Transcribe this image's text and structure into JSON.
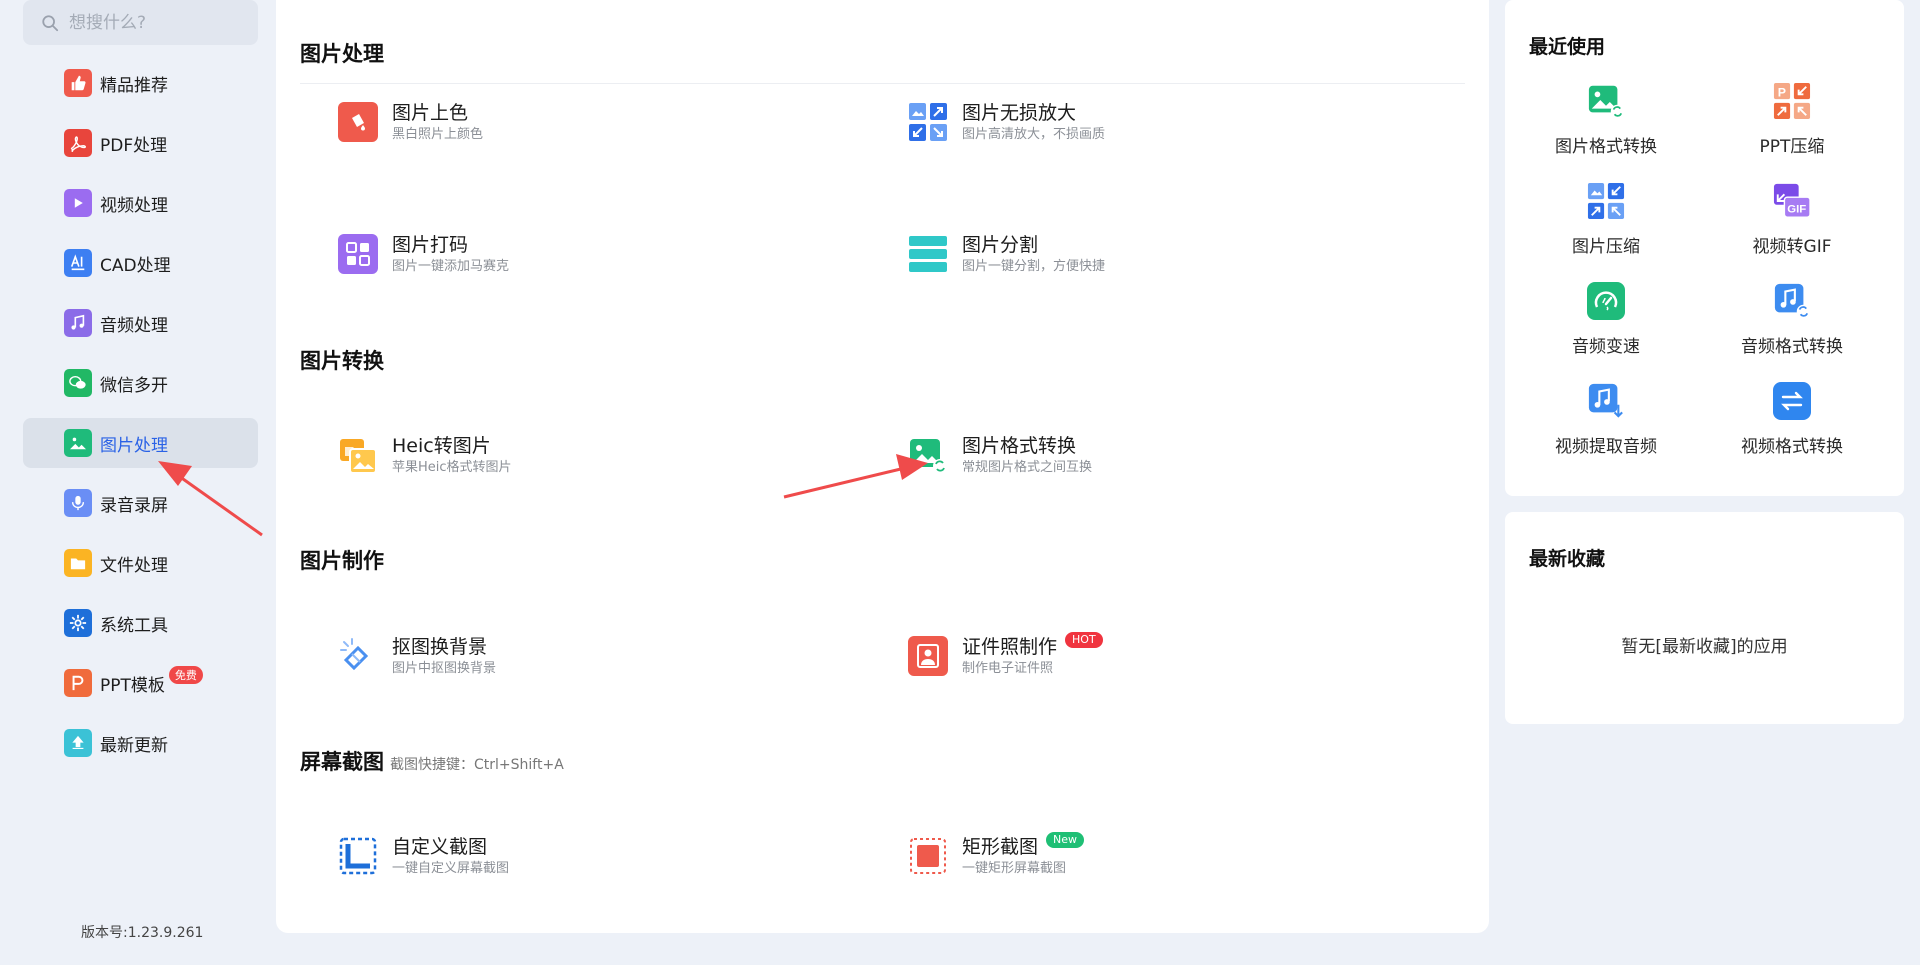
{
  "search": {
    "placeholder": "想搜什么?"
  },
  "sidebar": {
    "items": [
      {
        "label": "精品推荐",
        "color": "#ef5a4c"
      },
      {
        "label": "PDF处理",
        "color": "#e8453c"
      },
      {
        "label": "视频处理",
        "color": "#9b6cf0"
      },
      {
        "label": "CAD处理",
        "color": "#3d7ff2"
      },
      {
        "label": "音频处理",
        "color": "#8b6ce8"
      },
      {
        "label": "微信多开",
        "color": "#21b865"
      },
      {
        "label": "图片处理",
        "color": "#1fbb7b"
      },
      {
        "label": "录音录屏",
        "color": "#6a8ef5"
      },
      {
        "label": "文件处理",
        "color": "#fbb423"
      },
      {
        "label": "系统工具",
        "color": "#1e6fd9"
      },
      {
        "label": "PPT模板",
        "color": "#f06b3c",
        "badge": "免费"
      },
      {
        "label": "最新更新",
        "color": "#3bc2d6"
      }
    ],
    "version": "版本号:1.23.9.261"
  },
  "main": {
    "sections": [
      {
        "title": "图片处理",
        "subtitle": ""
      },
      {
        "title": "图片转换",
        "subtitle": ""
      },
      {
        "title": "图片制作",
        "subtitle": ""
      },
      {
        "title": "屏幕截图",
        "subtitle": "截图快捷键：Ctrl+Shift+A"
      }
    ],
    "tools": [
      {
        "name": "图片上色",
        "desc": "黑白照片上颜色"
      },
      {
        "name": "图片无损放大",
        "desc": "图片高清放大，不损画质"
      },
      {
        "name": "图片打码",
        "desc": "图片一键添加马赛克"
      },
      {
        "name": "图片分割",
        "desc": "图片一键分割，方便快捷"
      },
      {
        "name": "Heic转图片",
        "desc": "苹果Heic格式转图片"
      },
      {
        "name": "图片格式转换",
        "desc": "常规图片格式之间互换"
      },
      {
        "name": "抠图换背景",
        "desc": "图片中抠图换背景"
      },
      {
        "name": "证件照制作",
        "desc": "制作电子证件照",
        "badge": "HOT"
      },
      {
        "name": "自定义截图",
        "desc": "一键自定义屏幕截图"
      },
      {
        "name": "矩形截图",
        "desc": "一键矩形屏幕截图",
        "badge": "New"
      }
    ]
  },
  "recent": {
    "title": "最近使用",
    "items": [
      {
        "label": "图片格式转换"
      },
      {
        "label": "PPT压缩"
      },
      {
        "label": "图片压缩"
      },
      {
        "label": "视频转GIF"
      },
      {
        "label": "音频变速"
      },
      {
        "label": "音频格式转换"
      },
      {
        "label": "视频提取音频"
      },
      {
        "label": "视频格式转换"
      }
    ]
  },
  "favorites": {
    "title": "最新收藏",
    "empty_text": "暂无[最新收藏]的应用"
  },
  "colors": {
    "accent": "#2a62e6",
    "arrow": "#ef4b4b",
    "hot": "#f0343f",
    "new": "#1fbf75"
  }
}
